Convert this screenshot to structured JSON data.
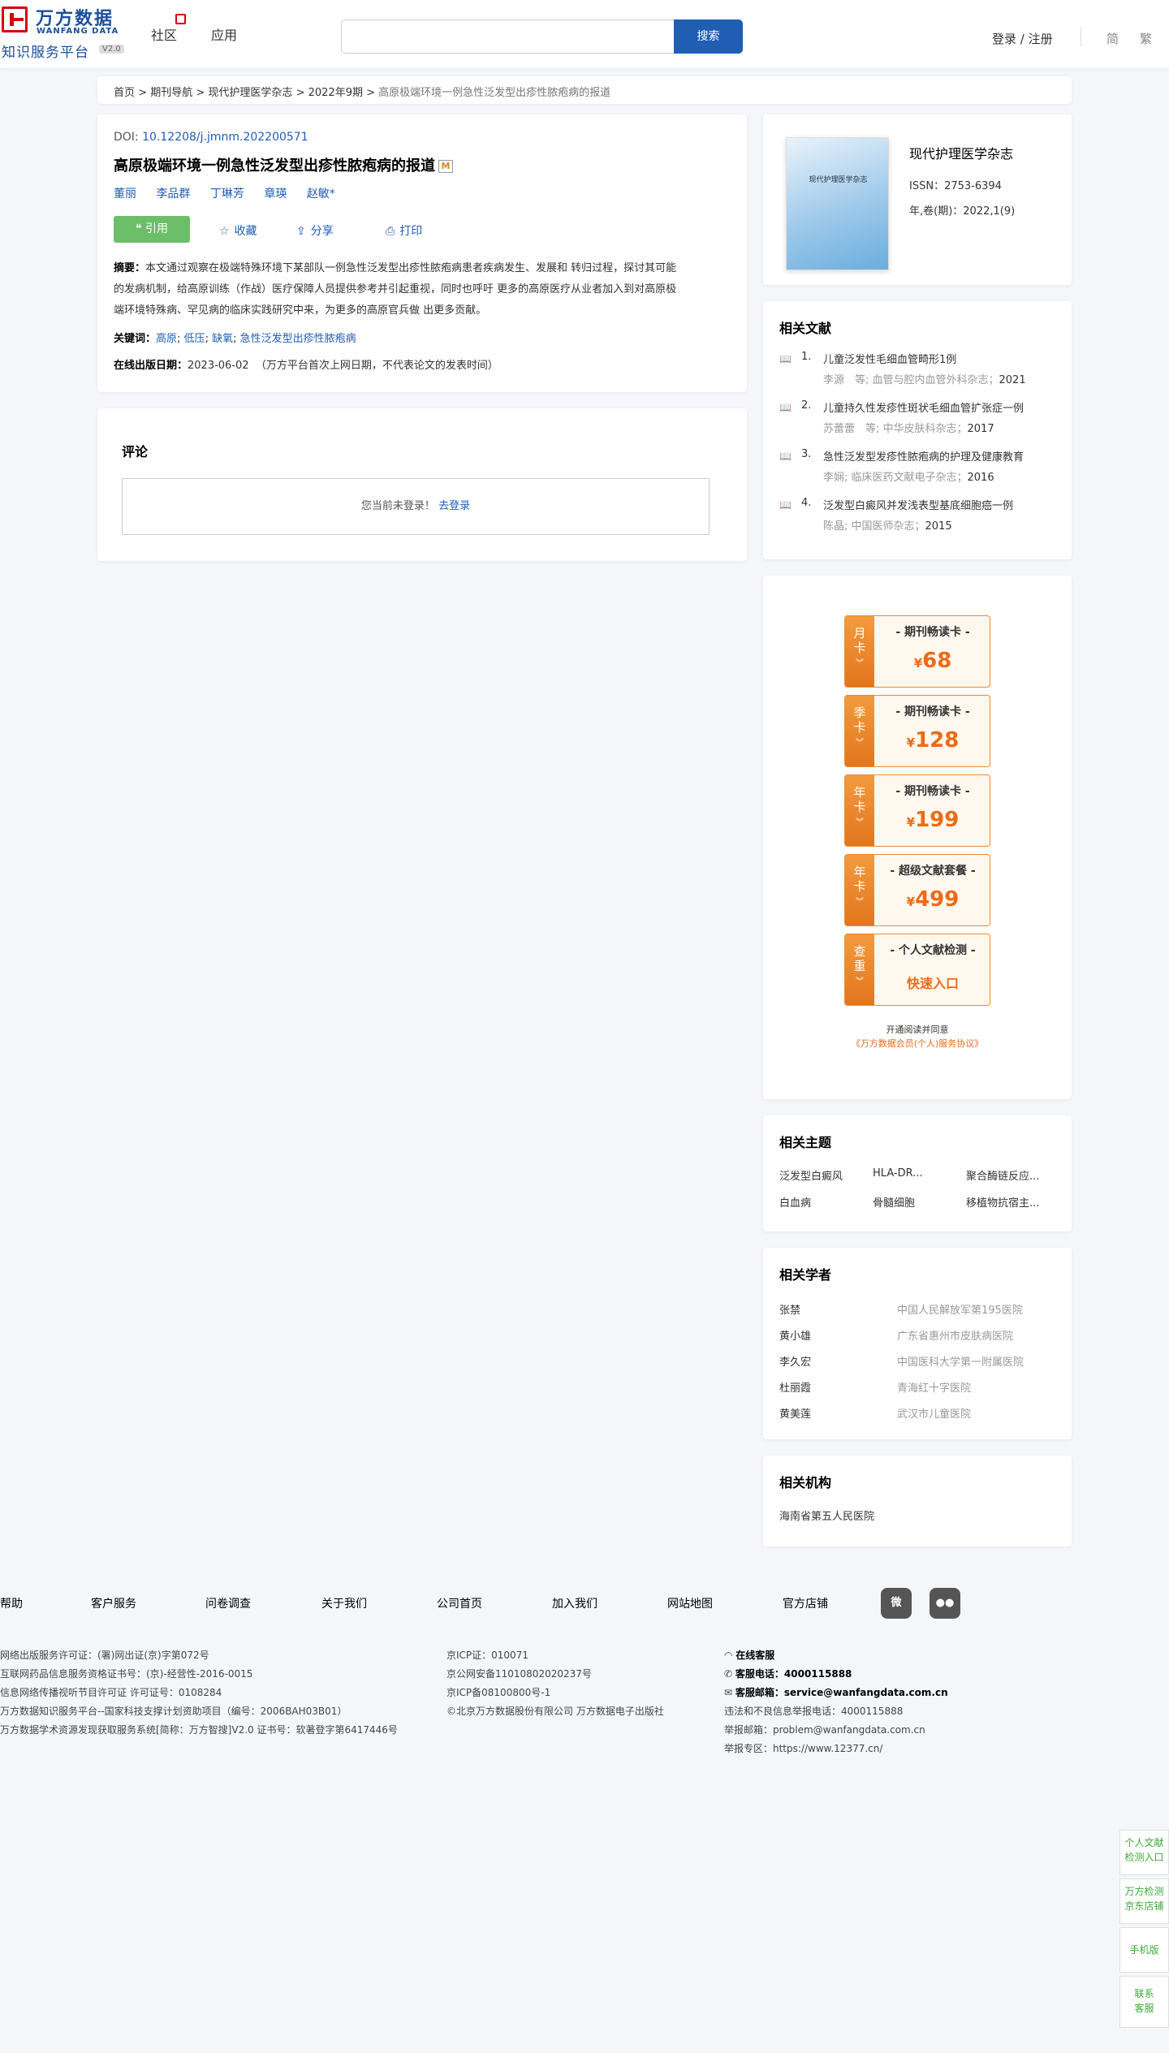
{
  "header": {
    "logo_cn": "万方数据",
    "logo_en": "WANFANG DATA",
    "platform": "知识服务平台",
    "version": "V2.0",
    "nav": [
      "社区",
      "应用"
    ],
    "search_placeholder": "",
    "search_button": "搜索",
    "login": "登录 / 注册",
    "lang_simplified": "简",
    "lang_traditional": "繁"
  },
  "breadcrumb": {
    "items": [
      "首页",
      "期刊导航",
      "现代护理医学杂志",
      "2022年9期"
    ],
    "current": "高原极端环境一例急性泛发型出疹性脓疱病的报道",
    "sep": ">"
  },
  "article": {
    "doi_label": "DOI:",
    "doi": "10.12208/j.jmnm.202200571",
    "title": "高原极端环境一例急性泛发型出疹性脓疱病的报道",
    "title_badge": "M",
    "authors": [
      "董丽",
      "李品群",
      "丁琳芳",
      "章瑛",
      "赵敏*"
    ],
    "actions": {
      "cite": "引用",
      "favorite": "收藏",
      "share": "分享",
      "print": "打印"
    },
    "abstract_label": "摘要：",
    "abstract_lines": [
      "本文通过观察在极端特殊环境下某部队一例急性泛发型出疹性脓疱病患者疾病发生、发展和 转归过程，探讨其可能",
      "的发病机制，给高原训练（作战）医疗保障人员提供参考并引起重视，同时也呼吁 更多的高原医疗从业者加入到对高原极",
      "端环境特殊病、罕见病的临床实践研究中来，为更多的高原官兵做 出更多贡献。"
    ],
    "keywords_label": "关键词：",
    "keywords": [
      "高原",
      "低压",
      "缺氧",
      "急性泛发型出疹性脓疱病"
    ],
    "pubdate_label": "在线出版日期：",
    "pubdate": "2023-06-02",
    "pubdate_note": "（万方平台首次上网日期，不代表论文的发表时间）"
  },
  "comment": {
    "title": "评论",
    "not_logged": "您当前未登录！",
    "login_link": "去登录"
  },
  "journal": {
    "cover_text": "现代护理医学杂志",
    "name": "现代护理医学杂志",
    "issn": "ISSN：2753-6394",
    "volume": "年,卷(期)：2022,1(9)"
  },
  "related_literature": {
    "title": "相关文献",
    "items": [
      {
        "num": "1.",
        "title": "儿童泛发性毛细血管畸形1例",
        "meta": "李源　等; 血管与腔内血管外科杂志；",
        "year": "2021"
      },
      {
        "num": "2.",
        "title": "儿童持久性发疹性斑状毛细血管扩张症一例",
        "meta": "苏蕾蕾　等; 中华皮肤科杂志；",
        "year": "2017"
      },
      {
        "num": "3.",
        "title": "急性泛发型发疹性脓疱病的护理及健康教育",
        "meta": "李娴; 临床医药文献电子杂志；",
        "year": "2016"
      },
      {
        "num": "4.",
        "title": "泛发型白癜风并发浅表型基底细胞癌一例",
        "meta": "陈晶; 中国医师杂志；",
        "year": "2015"
      }
    ]
  },
  "vip_cards": [
    {
      "tag": [
        "月",
        "卡"
      ],
      "title": "- 期刊畅读卡 -",
      "currency": "¥",
      "price": "68"
    },
    {
      "tag": [
        "季",
        "卡"
      ],
      "title": "- 期刊畅读卡 -",
      "currency": "¥",
      "price": "128"
    },
    {
      "tag": [
        "年",
        "卡"
      ],
      "title": "- 期刊畅读卡 -",
      "currency": "¥",
      "price": "199"
    },
    {
      "tag": [
        "年",
        "卡"
      ],
      "title": "- 超级文献套餐 -",
      "currency": "¥",
      "price": "499"
    },
    {
      "tag": [
        "查",
        "重"
      ],
      "title": "- 个人文献检测 -",
      "quick": "快速入口"
    }
  ],
  "agreement": {
    "line1": "开通阅读并同意",
    "link": "《万方数据会员(个人)服务协议》"
  },
  "topics": {
    "title": "相关主题",
    "items": [
      "泛发型白癜风",
      "HLA-DR...",
      "聚合酶链反应...",
      "白血病",
      "骨髓细胞",
      "移植物抗宿主..."
    ]
  },
  "scholars": {
    "title": "相关学者",
    "items": [
      {
        "name": "张禁",
        "org": "中国人民解放军第195医院"
      },
      {
        "name": "黄小雄",
        "org": "广东省惠州市皮肤病医院"
      },
      {
        "name": "李久宏",
        "org": "中国医科大学第一附属医院"
      },
      {
        "name": "杜丽霞",
        "org": "青海红十字医院"
      },
      {
        "name": "黄美莲",
        "org": "武汉市儿童医院"
      }
    ]
  },
  "institutions": {
    "title": "相关机构",
    "items": [
      "海南省第五人民医院"
    ]
  },
  "footer": {
    "links": [
      "帮助",
      "客户服务",
      "问卷调查",
      "关于我们",
      "公司首页",
      "加入我们",
      "网站地图",
      "官方店铺"
    ],
    "social": [
      "weibo-icon",
      "wechat-icon"
    ],
    "col1": [
      "网络出版服务许可证：(署)网出证(京)字第072号",
      "互联网药品信息服务资格证书号：(京)-经营性-2016-0015",
      "信息网络传播视听节目许可证 许可证号：0108284",
      "万方数据知识服务平台--国家科技支撑计划资助项目（编号：2006BAH03B01）",
      "万方数据学术资源发现获取服务系统[简称：万方智搜]V2.0 证书号：软著登字第6417446号"
    ],
    "col2": [
      "京ICP证：010071",
      "京公网安备11010802020237号",
      "京ICP备08100800号-1",
      "©北京万方数据股份有限公司 万方数据电子出版社"
    ],
    "col3": {
      "online": "在线客服",
      "phone_label": "客服电话：",
      "phone": "4000115888",
      "email_label": "客服邮箱：",
      "email": "service@wanfangdata.com.cn",
      "report_phone": "违法和不良信息举报电话：4000115888",
      "report_email": "举报邮箱：problem@wanfangdata.com.cn",
      "report_area": "举报专区：https://www.12377.cn/"
    }
  },
  "sidebar_float": [
    [
      "个人文献",
      "检测入口"
    ],
    [
      "万方检测",
      "京东店铺"
    ],
    [
      "手机版"
    ],
    [
      "联系",
      "客服"
    ]
  ],
  "colors": {
    "brand_blue": "#1f5eb3",
    "brand_red": "#d7000f",
    "cite_green": "#6cbf68",
    "vip_orange": "#ee6a16"
  }
}
